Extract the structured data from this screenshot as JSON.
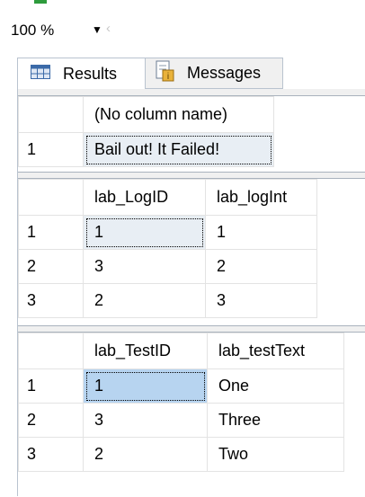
{
  "zoom": {
    "value": "100 %"
  },
  "tabs": [
    {
      "label": "Results",
      "icon": "grid-icon"
    },
    {
      "label": "Messages",
      "icon": "messages-icon"
    }
  ],
  "result_sets": [
    {
      "columns": [
        "(No column name)"
      ],
      "rows": [
        {
          "num": "1",
          "cells": [
            "Bail out! It Failed!"
          ]
        }
      ]
    },
    {
      "columns": [
        "lab_LogID",
        "lab_logInt"
      ],
      "rows": [
        {
          "num": "1",
          "cells": [
            "1",
            "1"
          ]
        },
        {
          "num": "2",
          "cells": [
            "3",
            "2"
          ]
        },
        {
          "num": "3",
          "cells": [
            "2",
            "3"
          ]
        }
      ]
    },
    {
      "columns": [
        "lab_TestID",
        "lab_testText"
      ],
      "rows": [
        {
          "num": "1",
          "cells": [
            "1",
            "One"
          ]
        },
        {
          "num": "2",
          "cells": [
            "3",
            "Three"
          ]
        },
        {
          "num": "3",
          "cells": [
            "2",
            "Two"
          ]
        }
      ]
    }
  ]
}
